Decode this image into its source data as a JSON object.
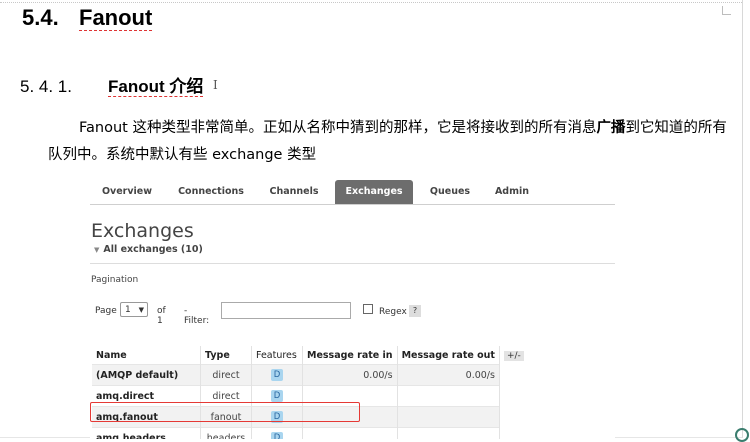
{
  "heading2": {
    "number": "5.4.",
    "title": "Fanout"
  },
  "heading3": {
    "number": "5. 4. 1.",
    "title": "Fanout 介绍"
  },
  "paragraph": {
    "part1": "Fanout 这种类型非常简单。正如从名称中猜到的那样，它是将接收到的所有消息",
    "bold": "广播",
    "part2": "到它知道的所有队列中。系统中默认有些 exchange 类型"
  },
  "rabbitmq": {
    "tabs": [
      "Overview",
      "Connections",
      "Channels",
      "Exchanges",
      "Queues",
      "Admin"
    ],
    "active_tab": "Exchanges",
    "title": "Exchanges",
    "all_exchanges": "All exchanges (10)",
    "pagination": {
      "label": "Pagination",
      "page_label": "Page",
      "page_value": "1",
      "of_label": "of 1",
      "filter_label": "- Filter:",
      "filter_value": "",
      "regex_label": "Regex",
      "help": "?"
    },
    "table": {
      "headers": [
        "Name",
        "Type",
        "Features",
        "Message rate in",
        "Message rate out",
        "+/-"
      ],
      "rows": [
        {
          "name": "(AMQP default)",
          "type": "direct",
          "feature": "D",
          "rate_in": "0.00/s",
          "rate_out": "0.00/s"
        },
        {
          "name": "amq.direct",
          "type": "direct",
          "feature": "D",
          "rate_in": "",
          "rate_out": ""
        },
        {
          "name": "amq.fanout",
          "type": "fanout",
          "feature": "D",
          "rate_in": "",
          "rate_out": ""
        },
        {
          "name": "amq.headers",
          "type": "headers",
          "feature": "D",
          "rate_in": "",
          "rate_out": ""
        }
      ],
      "highlighted_row": "amq.fanout"
    }
  },
  "colors": {
    "active_tab_bg": "#6d6d6d",
    "feature_badge_bg": "#a9d5ef",
    "highlight_box": "#e53935"
  }
}
